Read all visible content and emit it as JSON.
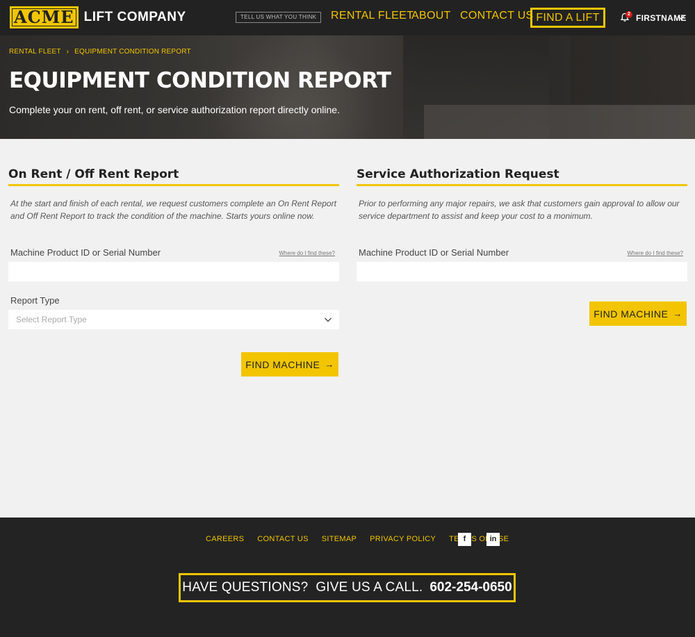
{
  "header": {
    "logo_mark": "ACME",
    "logo_text": "LIFT COMPANY",
    "feedback_label": "TELL US WHAT YOU THINK",
    "nav": {
      "rental_fleet": "RENTAL FLEET",
      "about": "ABOUT",
      "contact_us": "CONTACT US",
      "find_a_lift": "FIND A LIFT"
    },
    "notification_count": "2",
    "user_name": "FIRSTNAME"
  },
  "hero": {
    "breadcrumb": [
      "RENTAL FLEET",
      "EQUIPMENT CONDITION REPORT"
    ],
    "title": "EQUIPMENT CONDITION REPORT",
    "subtitle": "Complete your on rent, off rent, or service authorization report directly online."
  },
  "on_rent": {
    "title": "On Rent / Off Rent Report",
    "intro": "At the start and finish of each rental, we request customers complete an On Rent Report and Off Rent Report to track the condition of the machine. Starts yours online now.",
    "id_label": "Machine Product ID or Serial Number",
    "id_help": "Where do I find these?",
    "id_value": "",
    "report_type_label": "Report Type",
    "report_type_placeholder": "Select Report Type",
    "button_label": "FIND MACHINE"
  },
  "service": {
    "title": "Service Authorization Request",
    "intro": "Prior to performing any major repairs, we ask that customers gain approval to allow our service department to assist and keep your cost to a monimum.",
    "id_label": "Machine Product ID or Serial Number",
    "id_help": "Where do I find these?",
    "id_value": "",
    "button_label": "FIND MACHINE"
  },
  "footer": {
    "links": [
      "CAREERS",
      "CONTACT US",
      "SITEMAP",
      "PRIVACY POLICY",
      "TERMS OF USE"
    ],
    "social": {
      "facebook": "f",
      "linkedin": "in"
    },
    "cta_text": "HAVE QUESTIONS?  GIVE US A CALL.",
    "cta_phone": "602-254-0650"
  },
  "colors": {
    "accent": "#f2c500",
    "header_bg": "#222222",
    "page_bg": "#f1f1f1",
    "badge": "#d11c1c"
  }
}
